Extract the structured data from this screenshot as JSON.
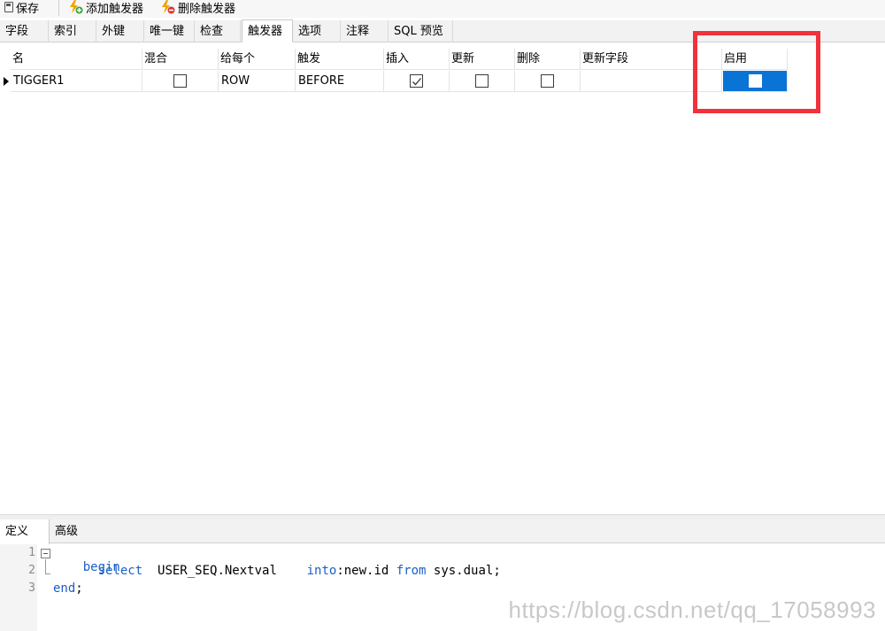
{
  "toolbar": {
    "save_label": "保存",
    "add_trigger_label": "添加触发器",
    "delete_trigger_label": "删除触发器"
  },
  "tabs": [
    {
      "label": "字段"
    },
    {
      "label": "索引"
    },
    {
      "label": "外键"
    },
    {
      "label": "唯一键"
    },
    {
      "label": "检查"
    },
    {
      "label": "触发器"
    },
    {
      "label": "选项"
    },
    {
      "label": "注释"
    },
    {
      "label": "SQL 预览"
    }
  ],
  "active_tab": "触发器",
  "grid": {
    "columns": [
      {
        "label": "名"
      },
      {
        "label": "混合"
      },
      {
        "label": "给每个"
      },
      {
        "label": "触发"
      },
      {
        "label": "插入"
      },
      {
        "label": "更新"
      },
      {
        "label": "删除"
      },
      {
        "label": "更新字段"
      },
      {
        "label": "启用"
      }
    ],
    "rows": [
      {
        "name": "TIGGER1",
        "mixed": false,
        "for_each": "ROW",
        "fire": "BEFORE",
        "insert": true,
        "update": false,
        "delete": false,
        "update_fields": "",
        "enabled": false
      }
    ]
  },
  "bottom_tabs": [
    {
      "label": "定义"
    },
    {
      "label": "高级"
    }
  ],
  "editor": {
    "line_numbers": [
      "1",
      "2",
      "3"
    ],
    "line1_kw": "begin",
    "line2_indent": "      ",
    "line2_kw1": "select",
    "line2_text1": "  USER_SEQ.Nextval    ",
    "line2_kw2": "into",
    "line2_text2": ":new.id ",
    "line2_kw3": "from",
    "line2_text3": " sys.dual;",
    "line3_kw": "end",
    "line3_text": ";"
  },
  "watermark": "https://blog.csdn.net/qq_17058993",
  "colors": {
    "selection": "#0a74d6",
    "highlight_box": "#f2323a",
    "keyword": "#1a5fc8"
  }
}
